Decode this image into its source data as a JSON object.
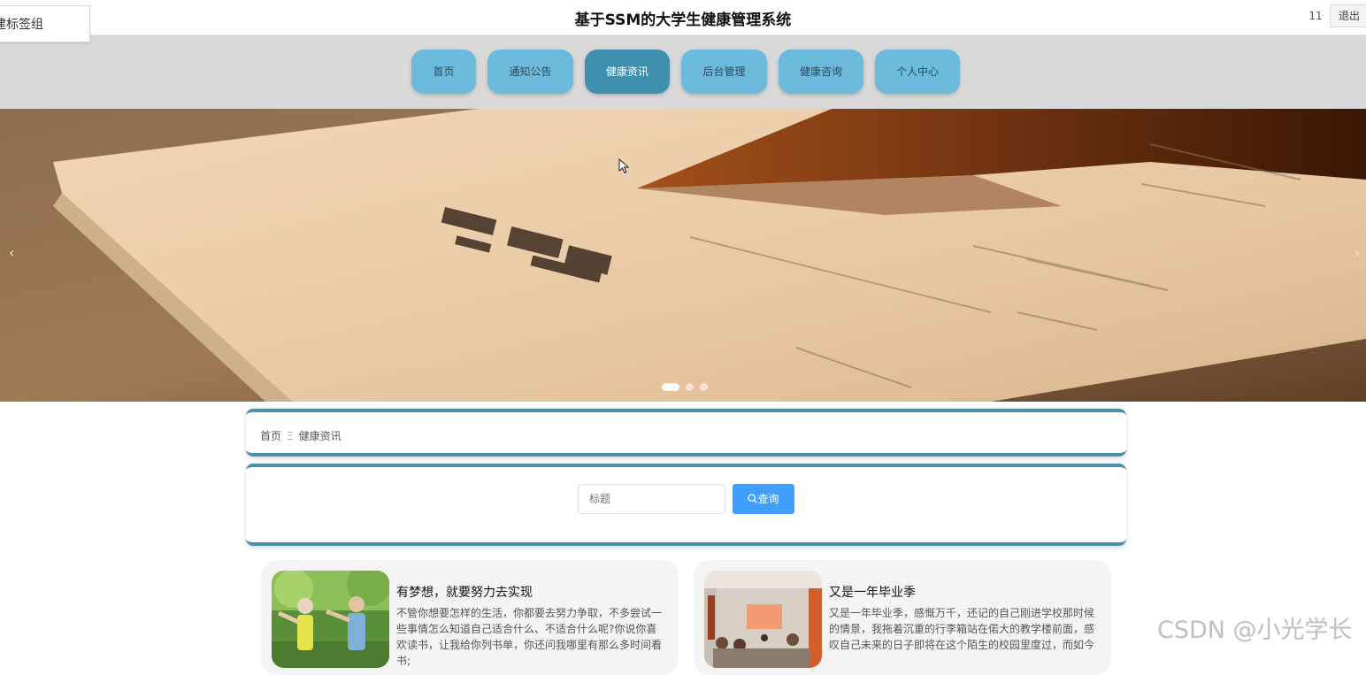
{
  "header": {
    "label_box": "建标签组",
    "title": "基于SSM的大学生健康管理系统",
    "user_count": "11",
    "logout": "退出"
  },
  "nav": {
    "items": [
      {
        "label": "首页"
      },
      {
        "label": "通知公告"
      },
      {
        "label": "健康资讯",
        "active": true
      },
      {
        "label": "后台管理"
      },
      {
        "label": "健康咨询"
      },
      {
        "label": "个人中心"
      }
    ]
  },
  "banner": {
    "prev": "‹",
    "next": "›",
    "slide_count": 3,
    "active_slide": 1
  },
  "breadcrumb": {
    "home": "首页",
    "separator": "Ξ",
    "current": "健康资讯"
  },
  "search": {
    "placeholder": "标题",
    "button": "查询"
  },
  "news": [
    {
      "title": "有梦想，就要努力去实现",
      "desc": "不管你想要怎样的生活，你都要去努力争取，不多尝试一些事情怎么知道自己适合什么、不适合什么呢?你说你喜欢读书，让我给你列书单，你还问我哪里有那么多时间看书;"
    },
    {
      "title": "又是一年毕业季",
      "desc": "又是一年毕业季，感慨万千，还记的自己刚进学校那时候的情景，我拖着沉重的行李箱站在偌大的教学楼前面，感叹自己未来的日子即将在这个陌生的校园里度过，而如今"
    }
  ],
  "watermark": "CSDN @小光学长",
  "colors": {
    "nav_bg": "#d9d9d9",
    "nav_item": "#6cbbdc",
    "nav_active": "#3f90ae",
    "panel_border": "#4a8fae",
    "button": "#409eff"
  }
}
